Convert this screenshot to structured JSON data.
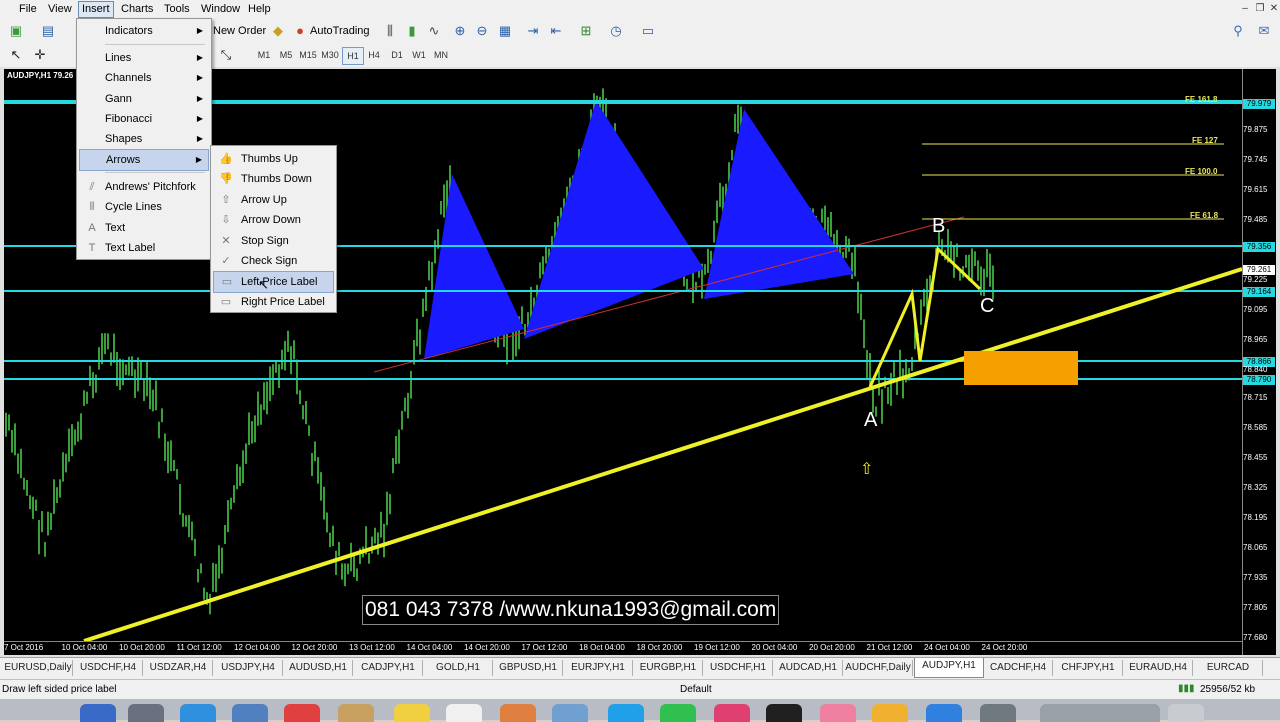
{
  "menubar": {
    "items": [
      "File",
      "View",
      "Insert",
      "Charts",
      "Tools",
      "Window",
      "Help"
    ],
    "active": "Insert"
  },
  "toolbar": {
    "new_order": "New Order",
    "autotrading": "AutoTrading",
    "timeframes": [
      "M1",
      "M5",
      "M15",
      "M30",
      "H1",
      "H4",
      "D1",
      "W1",
      "MN"
    ],
    "selected_timeframe": "H1"
  },
  "chart": {
    "title": "AUDJPY,H1  79.26",
    "price_labels": [
      "79.979",
      "79.745",
      "79.615",
      "79.485",
      "79.356",
      "79.261",
      "79.164",
      "79.095",
      "78.965",
      "78.866",
      "78.790",
      "78.840",
      "78.715",
      "78.585",
      "78.455",
      "78.325",
      "78.195",
      "78.065",
      "77.935",
      "77.805",
      "77.680",
      "79.875",
      "79.225"
    ],
    "time_labels": [
      "7 Oct 2016",
      "10 Oct 04:00",
      "10 Oct 20:00",
      "11 Oct 12:00",
      "12 Oct 04:00",
      "12 Oct 20:00",
      "13 Oct 12:00",
      "14 Oct 04:00",
      "14 Oct 20:00",
      "17 Oct 12:00",
      "18 Oct 04:00",
      "18 Oct 20:00",
      "19 Oct 12:00",
      "20 Oct 04:00",
      "20 Oct 20:00",
      "21 Oct 12:00",
      "24 Oct 04:00",
      "24 Oct 20:00"
    ],
    "fib_labels": [
      "FE 161.8",
      "FE 127",
      "FE 100.0",
      "FE 61.8"
    ],
    "wave_labels": [
      "A",
      "B",
      "C"
    ],
    "contact_text": "081 043 7378 /www.nkuna1993@gmail.com"
  },
  "insert_menu": {
    "items": [
      {
        "label": "Indicators",
        "submenu": true
      },
      {
        "label": "Lines",
        "submenu": true
      },
      {
        "label": "Channels",
        "submenu": true
      },
      {
        "label": "Gann",
        "submenu": true
      },
      {
        "label": "Fibonacci",
        "submenu": true
      },
      {
        "label": "Shapes",
        "submenu": true
      },
      {
        "label": "Arrows",
        "submenu": true
      },
      {
        "label": "Andrews' Pitchfork",
        "submenu": false
      },
      {
        "label": "Cycle Lines",
        "submenu": false
      },
      {
        "label": "Text",
        "submenu": false
      },
      {
        "label": "Text Label",
        "submenu": false
      }
    ],
    "highlighted": "Arrows"
  },
  "arrows_submenu": {
    "items": [
      "Thumbs Up",
      "Thumbs Down",
      "Arrow Up",
      "Arrow Down",
      "Stop Sign",
      "Check Sign",
      "Left Price Label",
      "Right Price Label"
    ],
    "highlighted": "Left Price Label"
  },
  "symbol_tabs": [
    "EURUSD,Daily",
    "USDCHF,H4",
    "USDZAR,H4",
    "USDJPY,H4",
    "AUDUSD,H1",
    "CADJPY,H1",
    "GOLD,H1",
    "GBPUSD,H1",
    "EURJPY,H1",
    "EURGBP,H1",
    "USDCHF,H1",
    "AUDCAD,H1",
    "AUDCHF,Daily",
    "AUDJPY,H1",
    "CADCHF,H4",
    "CHFJPY,H1",
    "EURAUD,H4",
    "EURCAD"
  ],
  "selected_tab": "AUDJPY,H1",
  "status": {
    "hint": "Draw left sided price label",
    "profile": "Default",
    "traffic": "25956/52 kb"
  },
  "colors": {
    "candle": "#4cd44c",
    "cyan_line": "#26d9e0",
    "trendline": "#f0f028",
    "pattern_fill": "#1a1aff",
    "orange_box": "#f5a000"
  }
}
